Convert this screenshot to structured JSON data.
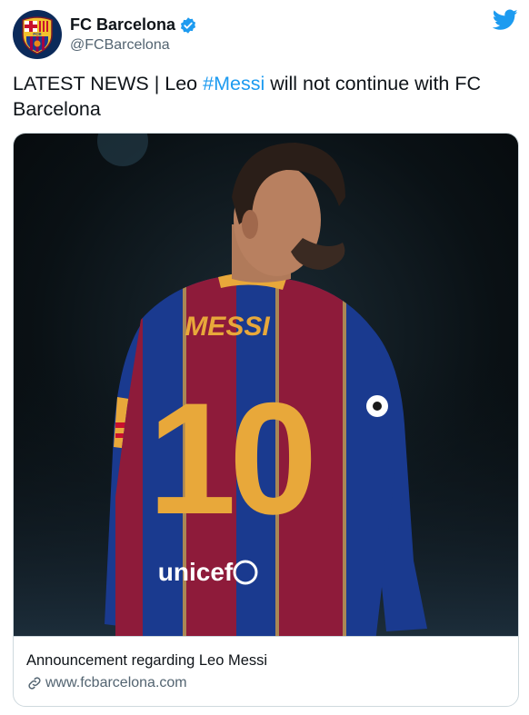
{
  "account": {
    "display_name": "FC Barcelona",
    "handle": "@FCBarcelona",
    "verified": true,
    "avatar_icon": "fc-barcelona-crest-icon",
    "crest_text": "FCB"
  },
  "tweet": {
    "text_before": "LATEST NEWS | Leo ",
    "hashtag": "#Messi",
    "text_after": " will not continue with FC Barcelona"
  },
  "card": {
    "image_jersey_name": "MESSI",
    "image_jersey_number": "10",
    "image_sponsor": "unicef",
    "title": "Announcement regarding Leo Messi",
    "domain": "www.fcbarcelona.com"
  },
  "colors": {
    "twitter_blue": "#1d9bf0",
    "text_primary": "#0f1419",
    "text_secondary": "#536471",
    "border": "#cfd9de",
    "barca_blue": "#1a3a8f",
    "barca_garnet": "#8e1b3a",
    "barca_gold": "#e8a83a"
  }
}
